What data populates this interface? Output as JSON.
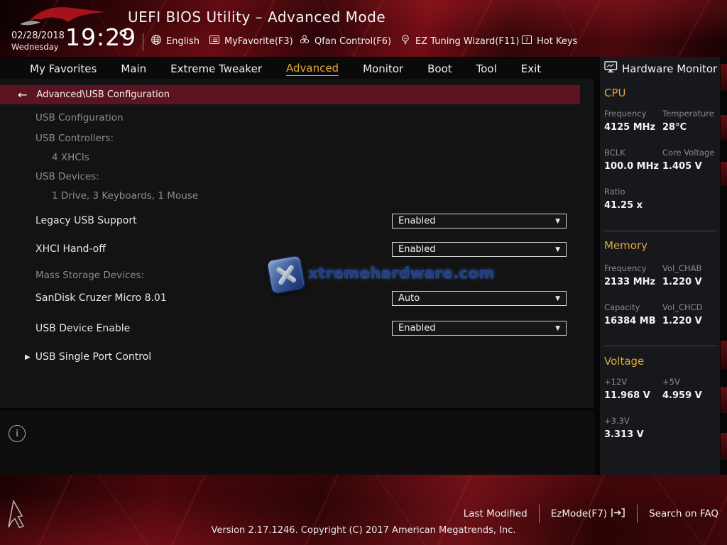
{
  "window": {
    "title": "UEFI BIOS Utility – Advanced Mode"
  },
  "header": {
    "date": "02/28/2018",
    "weekday": "Wednesday",
    "time": "19:29",
    "menu": {
      "language": "English",
      "my_favorite": "MyFavorite(F3)",
      "qfan": "Qfan Control(F6)",
      "ez_tuning": "EZ Tuning Wizard(F11)",
      "hot_keys": "Hot Keys"
    },
    "icons": {
      "language": "globe-icon",
      "my_favorite": "list-icon",
      "qfan": "fan-icon",
      "ez_tuning": "bulb-icon",
      "hot_keys": "question-icon",
      "time": "gear-icon"
    }
  },
  "nav": {
    "tabs": [
      "My Favorites",
      "Main",
      "Extreme Tweaker",
      "Advanced",
      "Monitor",
      "Boot",
      "Tool",
      "Exit"
    ],
    "active_tab": "Advanced"
  },
  "breadcrumb": {
    "path": "Advanced\\USB Configuration"
  },
  "content": {
    "heading": "USB Configuration",
    "info": [
      {
        "label": "USB Controllers:",
        "value": "4 XHCIs"
      },
      {
        "label": "USB Devices:",
        "value": "1 Drive, 3 Keyboards, 1 Mouse"
      }
    ],
    "settings": [
      {
        "label": "Legacy USB Support",
        "value": "Enabled"
      },
      {
        "label": "XHCI Hand-off",
        "value": "Enabled"
      },
      {
        "label": "SanDisk Cruzer Micro 8.01",
        "value": "Auto"
      },
      {
        "label": "USB Device Enable",
        "value": "Enabled"
      }
    ],
    "section_label": "Mass Storage Devices:",
    "submenu": "USB Single Port Control"
  },
  "watermark": {
    "text": "xtremehardware.com"
  },
  "sidebar": {
    "title": "Hardware Monitor",
    "cpu": {
      "title": "CPU",
      "stats": [
        {
          "label": "Frequency",
          "value": "4125 MHz"
        },
        {
          "label": "Temperature",
          "value": "28°C"
        },
        {
          "label": "BCLK",
          "value": "100.0 MHz"
        },
        {
          "label": "Core Voltage",
          "value": "1.405 V"
        },
        {
          "label": "Ratio",
          "value": "41.25 x"
        }
      ]
    },
    "memory": {
      "title": "Memory",
      "stats": [
        {
          "label": "Frequency",
          "value": "2133 MHz"
        },
        {
          "label": "Vol_CHAB",
          "value": "1.220 V"
        },
        {
          "label": "Capacity",
          "value": "16384 MB"
        },
        {
          "label": "Vol_CHCD",
          "value": "1.220 V"
        }
      ]
    },
    "voltage": {
      "title": "Voltage",
      "stats": [
        {
          "label": "+12V",
          "value": "11.968 V"
        },
        {
          "label": "+5V",
          "value": "4.959 V"
        },
        {
          "label": "+3.3V",
          "value": "3.313 V"
        }
      ]
    }
  },
  "footer": {
    "last_modified": "Last Modified",
    "ez_mode": "EzMode(F7)",
    "search_faq": "Search on FAQ",
    "version": "Version 2.17.1246. Copyright (C) 2017 American Megatrends, Inc."
  },
  "colors": {
    "accent_gold": "#e2a932",
    "breadcrumb_red": "#5c1520",
    "header_red": "#5a0a10"
  }
}
